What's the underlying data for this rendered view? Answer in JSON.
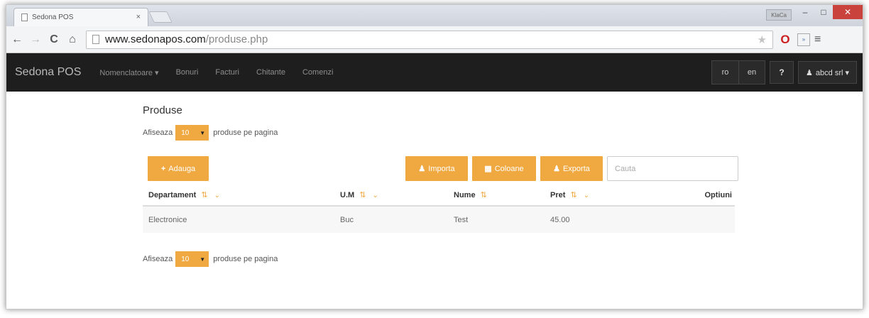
{
  "browser": {
    "tab_title": "Sedona POS",
    "tab_close": "×",
    "user_badge": "KlaCa",
    "url_host": "www.sedonapos.com",
    "url_path": "/produse.php",
    "controls": {
      "minimize": "–",
      "maximize": "□",
      "close": "✕"
    },
    "nav": {
      "back": "←",
      "forward": "→",
      "reload": "C",
      "home": "⌂",
      "star": "★",
      "menu": "≡",
      "ext_label": "»"
    }
  },
  "navbar": {
    "brand": "Sedona POS",
    "links": [
      "Nomenclatoare ▾",
      "Bonuri",
      "Facturi",
      "Chitante",
      "Comenzi"
    ],
    "lang_ro": "ro",
    "lang_en": "en",
    "help": "?",
    "user": "abcd srl ▾"
  },
  "page": {
    "title": "Produse",
    "perpage_prefix": "Afiseaza",
    "perpage_value": "10",
    "perpage_suffix": "produse pe pagina",
    "add_button": "Adauga",
    "import_button": "Importa",
    "columns_button": "Coloane",
    "export_button": "Exporta",
    "search_placeholder": "Cauta"
  },
  "table": {
    "headers": [
      "Departament",
      "U.M",
      "Nume",
      "Pret",
      "Optiuni"
    ],
    "rows": [
      {
        "departament": "Electronice",
        "um": "Buc",
        "nume": "Test",
        "pret": "45.00",
        "optiuni": ""
      }
    ]
  },
  "colors": {
    "accent": "#f0a940",
    "navbar": "#1e1e1e"
  }
}
